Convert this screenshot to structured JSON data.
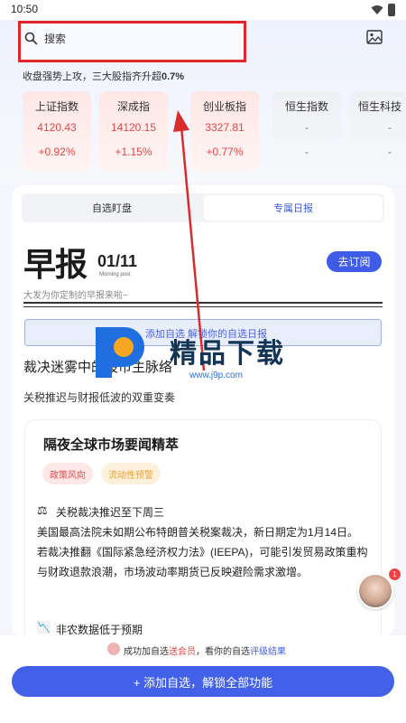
{
  "status_bar": {
    "time": "10:50"
  },
  "search": {
    "placeholder": "搜索"
  },
  "market_summary": {
    "text": "收盘强势上攻，三大股指齐升超",
    "percent": "0.7%"
  },
  "indices": [
    {
      "name": "上证指数",
      "value": "4120.43",
      "change": "+0.92%"
    },
    {
      "name": "深成指",
      "value": "14120.15",
      "change": "+1.15%"
    },
    {
      "name": "创业板指",
      "value": "3327.81",
      "change": "+0.77%"
    },
    {
      "name": "恒生指数",
      "value": "-",
      "change": "-"
    },
    {
      "name": "恒生科技",
      "value": "-",
      "change": "-"
    }
  ],
  "tabs": {
    "watchlist": "自选盯盘",
    "exclusive": "专属日报"
  },
  "brief": {
    "title": "早报",
    "date": "01/11",
    "subtitle_en": "Morning post",
    "subtitle": "大发为你定制的早报来啦~",
    "subscribe": "去订阅"
  },
  "banner": {
    "text": "添加自选 解锁你的自选日报"
  },
  "headline": {
    "title": "裁决迷雾中的股市主脉络",
    "subtitle": "关税推迟与财报低波的双重变奏"
  },
  "news_card": {
    "title": "隔夜全球市场要闻精萃",
    "tags": [
      "政策风向",
      "流动性预警"
    ],
    "item1_title": "关税裁决推迟至下周三",
    "item1_body": "美国最高法院未如期公布特朗普关税案裁决，新日期定为1月14日。若裁决推翻《国际紧急经济权力法》(IEEPA)，可能引发贸易政策重构与财政退款浪潮，市场波动率期货已反映避险需求激增。",
    "item2_title": "非农数据低于预期"
  },
  "avatar": {
    "badge": "1"
  },
  "toast": {
    "prefix": "成功加自选",
    "red": "送会员",
    "middle": "，看你的自选",
    "blue": "评级结果"
  },
  "add_button": {
    "label": "+ 添加自选，解锁全部功能"
  },
  "watermark": {
    "text": "精品下载",
    "url": "www.j9p.com"
  },
  "colors": {
    "accent_blue": "#3f5ce8",
    "up_red": "#e04848",
    "highlight_red": "#e0262a"
  }
}
